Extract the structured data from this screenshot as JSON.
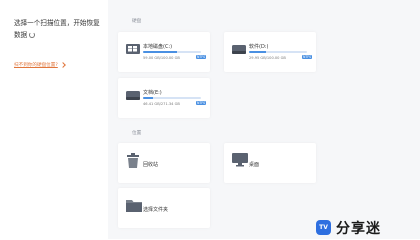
{
  "left": {
    "title": "选择一个扫描位置，开始恢复数据",
    "help_link": "扫不到你的硬盘位置?"
  },
  "sections": {
    "disks_label": "硬盘",
    "locations_label": "位置"
  },
  "disks": [
    {
      "name": "本地磁盘(C:)",
      "size": "59.00 GB/100.00 GB",
      "tag": "NTFS",
      "usage": 0.59
    },
    {
      "name": "软件(D:)",
      "size": "29.95 GB/100.00 GB",
      "tag": "NTFS",
      "usage": 0.3
    },
    {
      "name": "文档(E:)",
      "size": "46.41 GB/271.34 GB",
      "tag": "NTFS",
      "usage": 0.17
    }
  ],
  "locations": [
    {
      "name": "回收站"
    },
    {
      "name": "桌面"
    },
    {
      "name": "选择文件夹"
    }
  ],
  "brand": {
    "mark": "TV",
    "text": "分享迷"
  }
}
